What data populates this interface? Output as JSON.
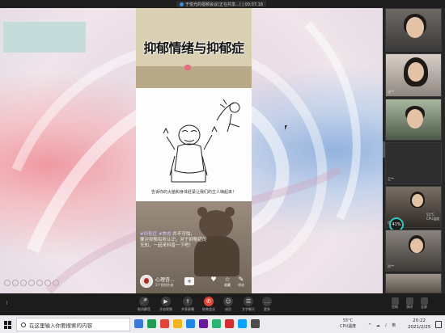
{
  "window": {
    "title": "于悦光的视频会议(正在共享...) | 00:07:18"
  },
  "post": {
    "title": "抑郁情绪与抑郁症",
    "sketch_caption": "告诉你的大脑和身体赶紧让我们的主人嗨起来！",
    "tags_line1_tags": "#抑郁症 #焦虑",
    "tags_line1_text": " 并不可怕，",
    "tags_line2": "要对抑郁有所认识，对于抑郁症的",
    "tags_line3": "无知，一起来科普一下吧！",
    "author_name": "心理咨...",
    "author_sub": "2个视频作者",
    "follow_label": "+",
    "actions": [
      {
        "icon": "♥",
        "label": ""
      },
      {
        "icon": "☆",
        "label": "收藏"
      },
      {
        "icon": "✎",
        "label": "评论"
      }
    ]
  },
  "participants": [
    {
      "name": "",
      "camera": true
    },
    {
      "name": "张**",
      "camera": true
    },
    {
      "name": "",
      "camera": true
    },
    {
      "name": "王**",
      "camera": false
    },
    {
      "name": "徐**",
      "camera": true
    },
    {
      "name": "孙**",
      "camera": true
    }
  ],
  "stats": {
    "gauge": "41%",
    "temp_value": "55°C",
    "temp_label": "CPU温度"
  },
  "toolbar": {
    "buttons": [
      {
        "icon": "🎤",
        "label": "取消静音",
        "red": false
      },
      {
        "icon": "▶",
        "label": "开启视频",
        "red": false
      },
      {
        "icon": "⇪",
        "label": "共享屏幕",
        "red": false
      },
      {
        "icon": "✆",
        "label": "结束会议",
        "red": true
      },
      {
        "icon": "☺",
        "label": "成员",
        "red": false
      },
      {
        "icon": "☰",
        "label": "文字聊天",
        "red": false
      },
      {
        "icon": "…",
        "label": "更多",
        "red": false
      }
    ],
    "right_buttons": [
      {
        "label": "宫格"
      },
      {
        "label": "演讲"
      },
      {
        "label": "全屏"
      }
    ]
  },
  "taskbar": {
    "search_placeholder": "在这里输入你要搜索的内容",
    "weather_temp": "55°C",
    "weather_label": "CPU温度",
    "tray": "^ ☁ ♪ 英",
    "time": "20:22",
    "date": "2021/2/25",
    "app_colors": [
      "#3c78d8",
      "#1f9d55",
      "#e0453a",
      "#f3b61f",
      "#1e88e5",
      "#6a1b9a",
      "#2bb673",
      "#d32f2f",
      "#0aa1ff",
      "#4c4c4c"
    ]
  }
}
